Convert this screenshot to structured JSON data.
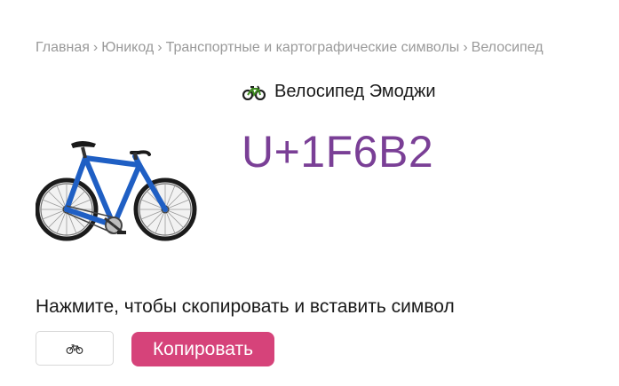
{
  "breadcrumb": {
    "items": [
      {
        "label": "Главная"
      },
      {
        "label": "Юникод"
      },
      {
        "label": "Транспортные и картографические символы"
      },
      {
        "label": "Велосипед"
      }
    ],
    "separator": "›"
  },
  "header": {
    "title": "Велосипед Эмоджи",
    "icon": "bicycle-icon"
  },
  "symbol": {
    "code": "U+1F6B2",
    "image": "bicycle-emoji-image"
  },
  "copy": {
    "label": "Нажмите, чтобы скопировать и вставить символ",
    "char_value": "🚲",
    "button_label": "Копировать"
  },
  "colors": {
    "code": "#7a3f96",
    "button": "#d6437a",
    "breadcrumb": "#9a9a9a",
    "bike_frame": "#1f5fc4"
  }
}
